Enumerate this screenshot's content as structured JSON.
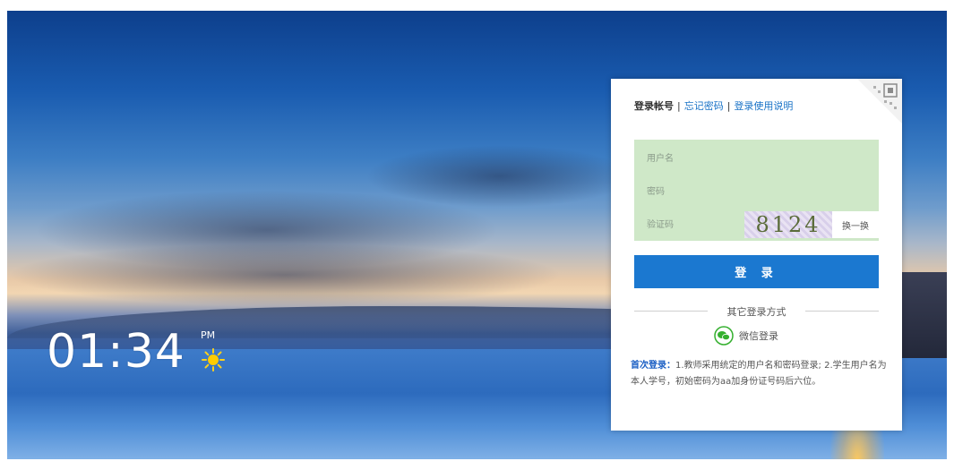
{
  "clock": {
    "time": "01:34",
    "ampm": "PM"
  },
  "login": {
    "tab_account": "登录帐号",
    "tab_forgot": "忘记密码",
    "tab_help": "登录使用说明",
    "separator": "|",
    "username_placeholder": "用户名",
    "password_placeholder": "密码",
    "captcha_placeholder": "验证码",
    "captcha_text": "8124",
    "captcha_refresh": "换一换",
    "login_button": "登 录",
    "other_methods": "其它登录方式",
    "wechat_login": "微信登录",
    "notice_head": "首次登录：",
    "notice_text": "1.教师采用统定的用户名和密码登录; 2.学生用户名为本人学号，初始密码为aa加身份证号码后六位。"
  },
  "colors": {
    "button": "#1b78d0",
    "fields_bg": "#cfe8c8",
    "link": "#1a73c7"
  }
}
